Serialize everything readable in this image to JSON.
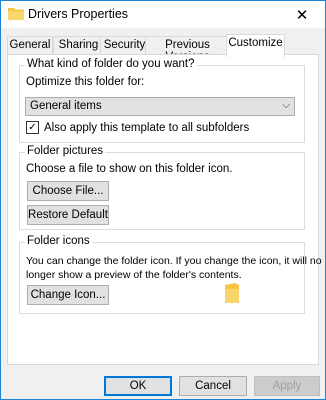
{
  "window": {
    "title": "Drivers Properties"
  },
  "tabs": [
    {
      "label": "General"
    },
    {
      "label": "Sharing"
    },
    {
      "label": "Security"
    },
    {
      "label": "Previous Versions"
    },
    {
      "label": "Customize"
    }
  ],
  "folder_type": {
    "group_label": "What kind of folder do you want?",
    "optimize_label": "Optimize this folder for:",
    "selected": "General items",
    "apply_subfolders_label": "Also apply this template to all subfolders",
    "apply_subfolders_checked": true
  },
  "folder_pictures": {
    "group_label": "Folder pictures",
    "description": "Choose a file to show on this folder icon.",
    "choose_file_label": "Choose File...",
    "restore_default_label": "Restore Default"
  },
  "folder_icons": {
    "group_label": "Folder icons",
    "description_line1": "You can change the folder icon. If you change the icon, it will no",
    "description_line2": "longer show a preview of the folder's contents.",
    "change_icon_label": "Change Icon..."
  },
  "footer": {
    "ok_label": "OK",
    "cancel_label": "Cancel",
    "apply_label": "Apply"
  },
  "icons": {
    "close": "close-icon",
    "folder": "folder-icon",
    "check": "checkmark-icon",
    "chevron": "chevron-down-icon"
  },
  "colors": {
    "accent": "#0078d7",
    "folder": "#f5c542"
  }
}
